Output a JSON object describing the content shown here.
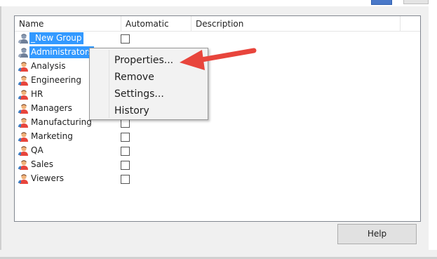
{
  "columns": {
    "name": "Name",
    "automatic": "Automatic",
    "description": "Description"
  },
  "groups": [
    {
      "name": "_New Group",
      "selected": true,
      "icon": "group-gray-icon"
    },
    {
      "name": "Administrators",
      "selected": true,
      "icon": "group-gray-icon"
    },
    {
      "name": "Analysis",
      "selected": false,
      "icon": "user-group-icon"
    },
    {
      "name": "Engineering",
      "selected": false,
      "icon": "user-group-icon"
    },
    {
      "name": "HR",
      "selected": false,
      "icon": "user-group-icon"
    },
    {
      "name": "Managers",
      "selected": false,
      "icon": "user-group-icon"
    },
    {
      "name": "Manufacturing",
      "selected": false,
      "icon": "user-group-icon"
    },
    {
      "name": "Marketing",
      "selected": false,
      "icon": "user-group-icon"
    },
    {
      "name": "QA",
      "selected": false,
      "icon": "user-group-icon"
    },
    {
      "name": "Sales",
      "selected": false,
      "icon": "user-group-icon"
    },
    {
      "name": "Viewers",
      "selected": false,
      "icon": "user-group-icon"
    }
  ],
  "context_menu": [
    "Properties...",
    "Remove",
    "Settings...",
    "History"
  ],
  "help_label": "Help",
  "colors": {
    "selection": "#3399ff",
    "arrow": "#e8453c"
  }
}
